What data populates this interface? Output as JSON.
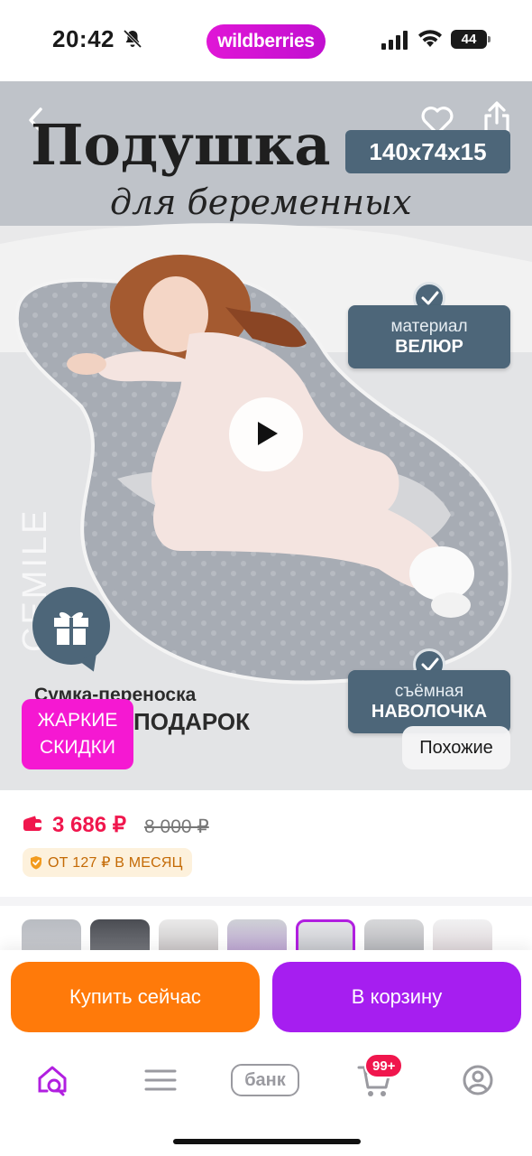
{
  "status_bar": {
    "time": "20:42",
    "brand": "wildberries",
    "battery": "44"
  },
  "hero": {
    "title": "Подушка",
    "size_badge": "140x74x15",
    "subtitle": "для беременных",
    "brand_watermark": "CEMILE",
    "feature_material": {
      "line1": "материал",
      "line2": "ВЕЛЮР"
    },
    "feature_cover": {
      "line1": "съёмная",
      "line2": "НАВОЛОЧКА"
    },
    "promo_line1": "Сумка-переноска",
    "promo_line2": "ПОДАРОК",
    "sale_badge": {
      "line1": "ЖАРКИЕ",
      "line2": "СКИДКИ"
    },
    "similar_button": "Похожие",
    "colors": {
      "card": "#4d6679",
      "sale": "#f518d2"
    }
  },
  "price": {
    "current": "3 686 ₽",
    "old": "8 000 ₽",
    "installment": "ОТ 127 ₽ В МЕСЯЦ",
    "price_color": "#f0164d"
  },
  "thumbnails": [
    {
      "label": "thumb-1",
      "selected": false
    },
    {
      "label": "thumb-2",
      "selected": false
    },
    {
      "label": "thumb-3",
      "selected": false
    },
    {
      "label": "thumb-4",
      "selected": false
    },
    {
      "label": "thumb-5",
      "selected": true
    },
    {
      "label": "thumb-6",
      "selected": false
    },
    {
      "label": "thumb-7",
      "selected": false
    }
  ],
  "actions": {
    "buy_now": "Купить сейчас",
    "to_cart": "В корзину",
    "buy_color": "#ff7a0a",
    "cart_color": "#a61ef0"
  },
  "tabbar": {
    "bank": "банк",
    "cart_badge": "99+",
    "icons": [
      "home-search-icon",
      "catalog-menu-icon",
      "bank-icon",
      "cart-icon",
      "profile-icon"
    ]
  }
}
